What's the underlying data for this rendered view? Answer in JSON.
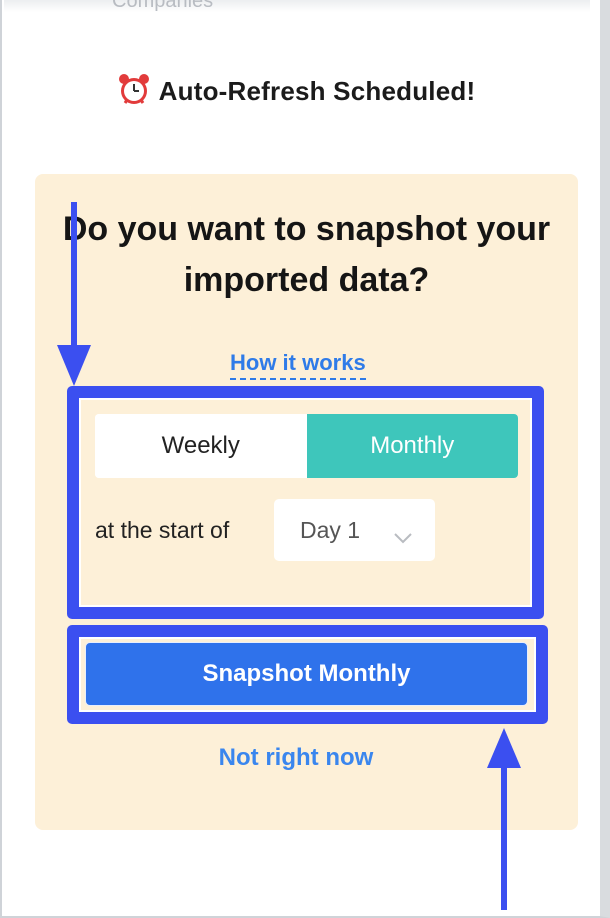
{
  "background": {
    "cut_off_text": "Companies"
  },
  "modal": {
    "title": "Auto-Refresh Scheduled!",
    "title_icon": "alarm-clock-icon"
  },
  "card": {
    "question": "Do you want to snapshot your imported data?",
    "how_link": "How it works",
    "frequency": {
      "options": [
        "Weekly",
        "Monthly"
      ],
      "selected": "Monthly"
    },
    "start_label": "at the start of",
    "day_select": {
      "value": "Day 1",
      "icon": "chevron-down-icon"
    },
    "primary_button": "Snapshot Monthly",
    "secondary_link": "Not right now"
  },
  "colors": {
    "card_bg": "#fdf0d8",
    "accent_teal": "#3ec6bb",
    "primary_blue": "#2f72eb",
    "link_blue": "#2f7be8",
    "annotation_blue": "#3b4ff0"
  }
}
